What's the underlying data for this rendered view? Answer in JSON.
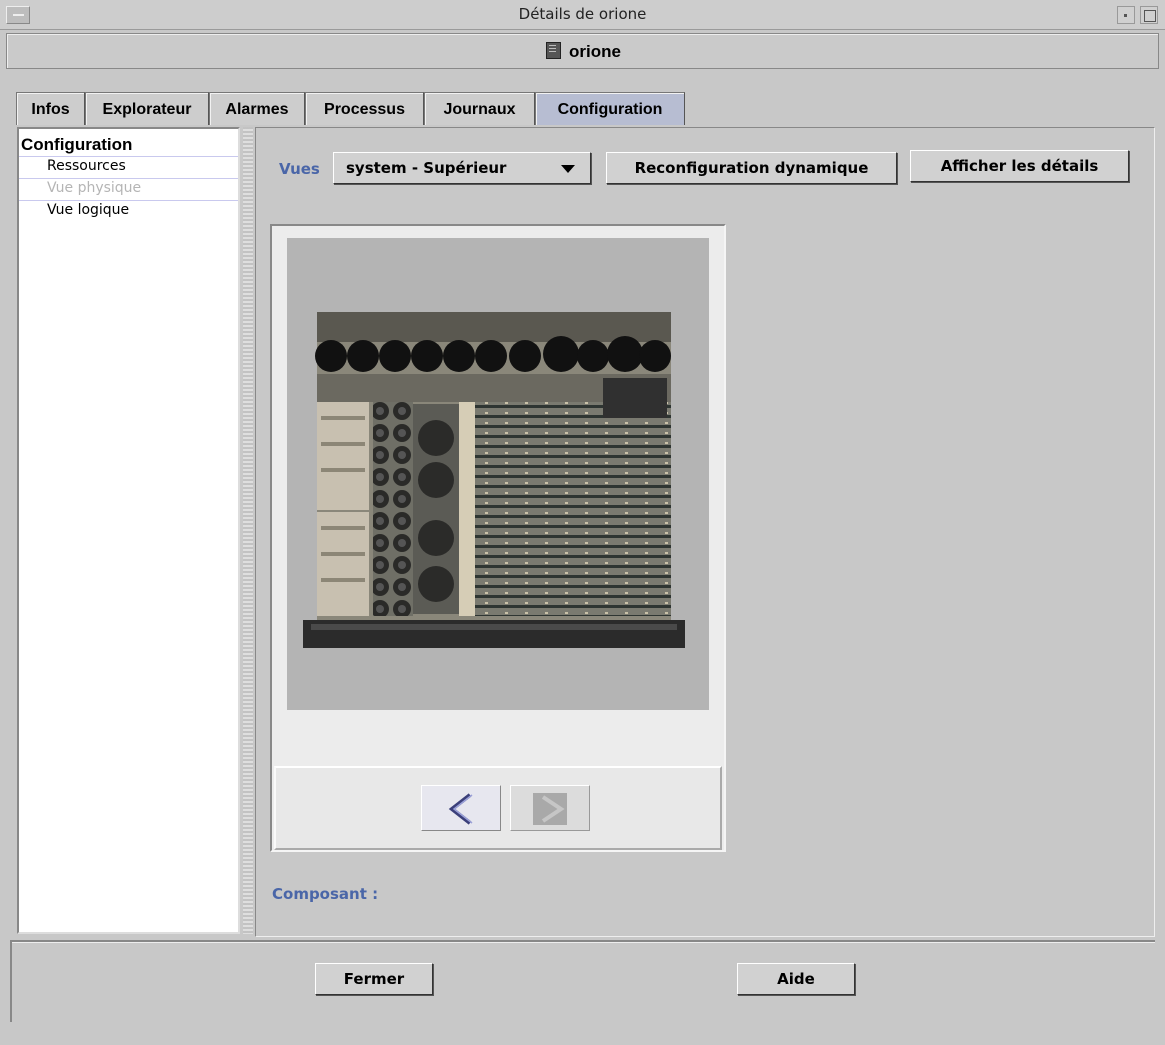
{
  "window": {
    "title": "Détails de orione"
  },
  "header": {
    "host": "orione"
  },
  "tabs": [
    {
      "label": "Infos"
    },
    {
      "label": "Explorateur"
    },
    {
      "label": "Alarmes"
    },
    {
      "label": "Processus"
    },
    {
      "label": "Journaux"
    },
    {
      "label": "Configuration",
      "active": true
    }
  ],
  "sidebar": {
    "title": "Configuration",
    "items": [
      {
        "label": "Ressources"
      },
      {
        "label": "Vue physique",
        "disabled": true
      },
      {
        "label": "Vue logique"
      }
    ]
  },
  "toolbar": {
    "views_label": "Vues",
    "view_selected": "system - Supérieur",
    "reconfig_label": "Reconfiguration dynamique",
    "details_label": "Afficher les détails"
  },
  "viewer": {
    "image": "system-board-photo",
    "prev_icon": "chevron-left-icon",
    "next_icon": "chevron-right-icon"
  },
  "component": {
    "label": "Composant :"
  },
  "footer": {
    "close_label": "Fermer",
    "help_label": "Aide"
  },
  "colors": {
    "accent_text": "#4a66a8",
    "active_tab": "#b7bdd2"
  }
}
